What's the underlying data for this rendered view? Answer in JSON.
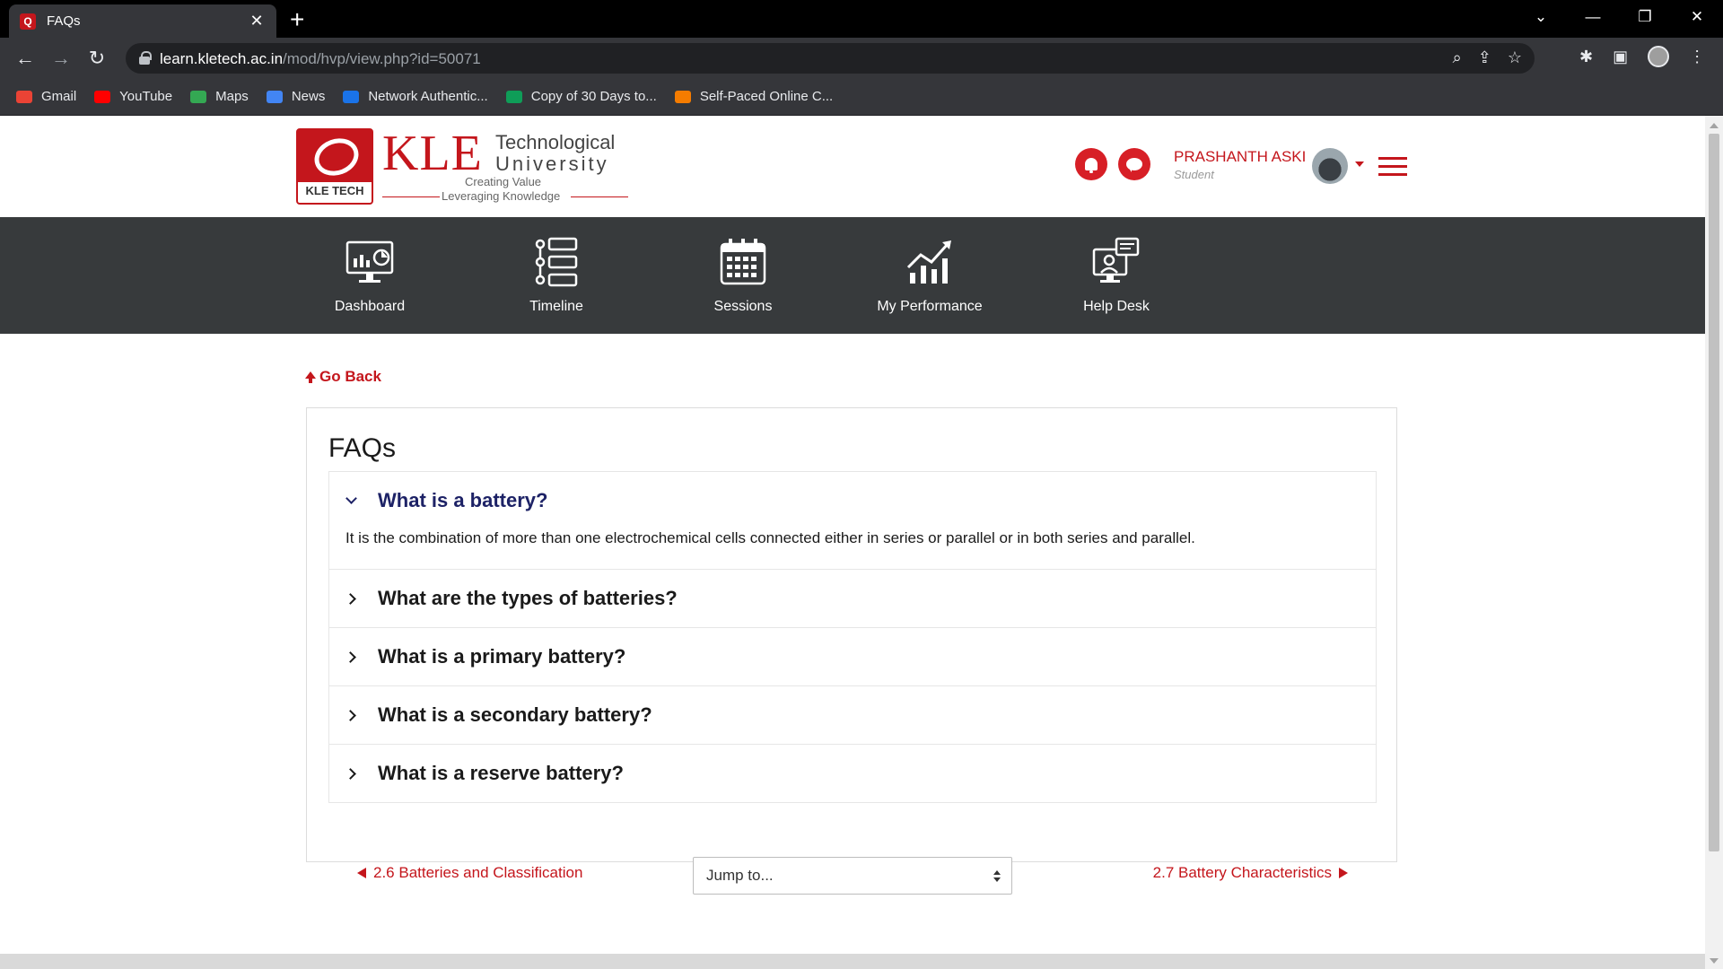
{
  "browser": {
    "tab_title": "FAQs",
    "url_host": "learn.kletech.ac.in",
    "url_path": "/mod/hvp/view.php?id=50071",
    "bookmarks": [
      {
        "label": "Gmail",
        "color": "#ea4335"
      },
      {
        "label": "YouTube",
        "color": "#ff0000"
      },
      {
        "label": "Maps",
        "color": "#34a853"
      },
      {
        "label": "News",
        "color": "#4285f4"
      },
      {
        "label": "Network Authentic...",
        "color": "#1a73e8"
      },
      {
        "label": "Copy of 30 Days to...",
        "color": "#0f9d58"
      },
      {
        "label": "Self-Paced Online C...",
        "color": "#f57c00"
      }
    ]
  },
  "header": {
    "logo_mark": "KLE TECH",
    "logo_kle": "KLE",
    "logo_line1": "Technological",
    "logo_line2": "University",
    "logo_tag1": "Creating Value",
    "logo_tag2": "Leveraging Knowledge",
    "user_name": "PRASHANTH ASKI",
    "user_role": "Student"
  },
  "nav": {
    "items": [
      {
        "label": "Dashboard",
        "icon": "dashboard-icon"
      },
      {
        "label": "Timeline",
        "icon": "timeline-icon"
      },
      {
        "label": "Sessions",
        "icon": "calendar-icon"
      },
      {
        "label": "My Performance",
        "icon": "performance-chart-icon"
      },
      {
        "label": "Help Desk",
        "icon": "help-desk-icon"
      }
    ]
  },
  "content": {
    "go_back": "Go Back",
    "title": "FAQs",
    "faqs": [
      {
        "question": "What is a battery?",
        "answer": "It is the combination of more than one electrochemical cells connected either in series or parallel or in both series and parallel.",
        "open": true
      },
      {
        "question": "What are the types of batteries?",
        "open": false
      },
      {
        "question": "What is a primary battery?",
        "open": false
      },
      {
        "question": "What is a secondary battery?",
        "open": false
      },
      {
        "question": "What is a reserve battery?",
        "open": false
      }
    ],
    "prev_link": "2.6 Batteries and Classification",
    "jump_placeholder": "Jump to...",
    "next_link": "2.7 Battery Characteristics"
  },
  "colors": {
    "brand_red": "#c4161c",
    "nav_bg": "#373a3c",
    "faq_open": "#1d2266"
  }
}
